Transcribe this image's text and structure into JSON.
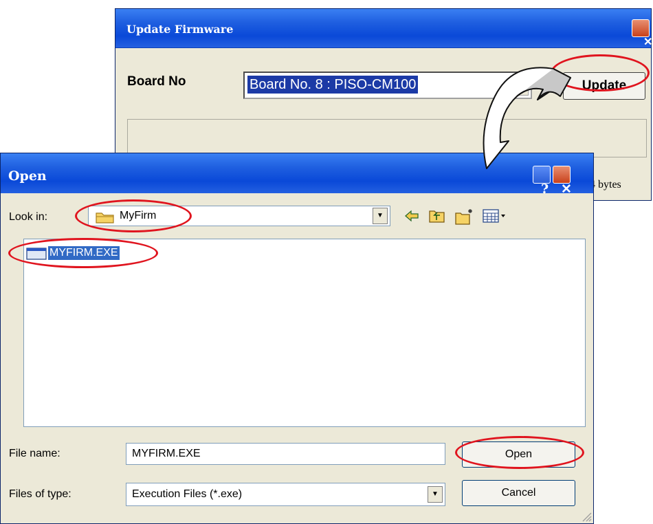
{
  "update_firmware": {
    "title": "Update Firmware",
    "board_label": "Board No",
    "board_value": "Board No. 8 : PISO-CM100",
    "update_button": "Update",
    "status_text": "4 bytes"
  },
  "open_dialog": {
    "title": "Open",
    "help_button": "?",
    "look_in_label": "Look in:",
    "look_in_value": "MyFirm",
    "files": [
      {
        "name": "MYFIRM.EXE",
        "selected": true
      }
    ],
    "file_name_label": "File name:",
    "file_name_value": "MYFIRM.EXE",
    "files_of_type_label": "Files of type:",
    "files_of_type_value": "Execution Files (*.exe)",
    "open_button": "Open",
    "cancel_button": "Cancel",
    "toolbar_icons": [
      "back-arrow-icon",
      "up-folder-icon",
      "new-folder-icon",
      "view-menu-icon"
    ]
  },
  "colors": {
    "title_bar": "#0a49d8",
    "window_bg": "#ece9d8",
    "selection": "#316ac5",
    "annotation": "#e0141e"
  }
}
